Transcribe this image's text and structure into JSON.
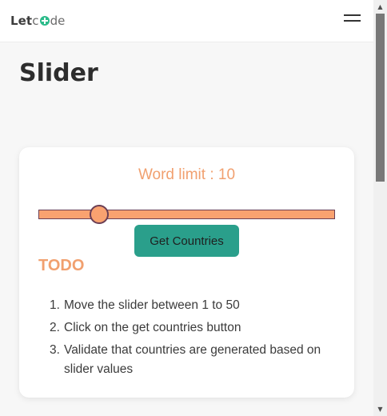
{
  "brand": {
    "part1": "Let",
    "part2": "de"
  },
  "page": {
    "title": "Slider"
  },
  "card": {
    "word_limit_label": "Word limit : 10",
    "slider": {
      "value": 10,
      "min": 1,
      "max": 50
    },
    "button_label": "Get Countries",
    "todo_title": "TODO",
    "todo_items": [
      {
        "num": "1.",
        "text": "Move the slider between 1 to 50"
      },
      {
        "num": "2.",
        "text": "Click on the get countries button"
      },
      {
        "num": "3.",
        "text": "Validate that countries are generated based on slider values"
      }
    ]
  },
  "colors": {
    "accent_orange": "#f1a06f",
    "slider_fill": "#f9a270",
    "slider_border": "#6b3f55",
    "button_teal": "#2a9f8b"
  },
  "icons": {
    "menu": "hamburger-icon",
    "brand_plus": "plus-circle-icon",
    "scroll_up": "triangle-up-icon",
    "scroll_down": "triangle-down-icon"
  }
}
